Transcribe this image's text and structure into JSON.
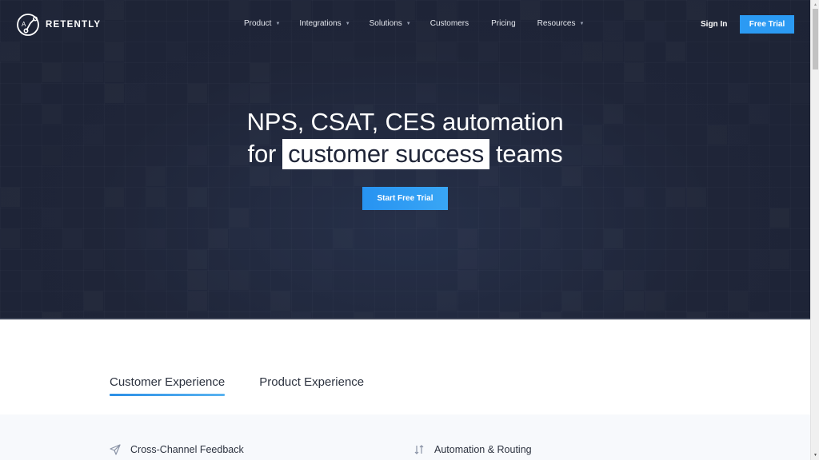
{
  "brand": {
    "name": "RETENTLY",
    "logo_icon": "retently-logo-icon"
  },
  "nav": {
    "items": [
      {
        "label": "Product",
        "has_dropdown": true
      },
      {
        "label": "Integrations",
        "has_dropdown": true
      },
      {
        "label": "Solutions",
        "has_dropdown": true
      },
      {
        "label": "Customers",
        "has_dropdown": false
      },
      {
        "label": "Pricing",
        "has_dropdown": false
      },
      {
        "label": "Resources",
        "has_dropdown": true
      }
    ],
    "caret_glyph": "▼",
    "sign_in": "Sign In",
    "free_trial": "Free Trial"
  },
  "hero": {
    "line1": "NPS, CSAT, CES automation",
    "line2_prefix": "for",
    "line2_highlight": "customer success",
    "line2_suffix": "teams",
    "cta": "Start Free Trial"
  },
  "tabs": [
    {
      "label": "Customer Experience",
      "active": true
    },
    {
      "label": "Product Experience",
      "active": false
    }
  ],
  "features": [
    {
      "label": "Cross-Channel Feedback",
      "icon": "paper-plane-icon"
    },
    {
      "label": "Automation & Routing",
      "icon": "swap-arrows-icon"
    }
  ],
  "colors": {
    "hero_bg": "#1f2538",
    "accent_blue": "#2b9af3",
    "text_dark": "#2d3340",
    "features_bg": "#f7f9fc"
  },
  "scrollbar": {
    "up_glyph": "▲",
    "down_glyph": "▼"
  }
}
